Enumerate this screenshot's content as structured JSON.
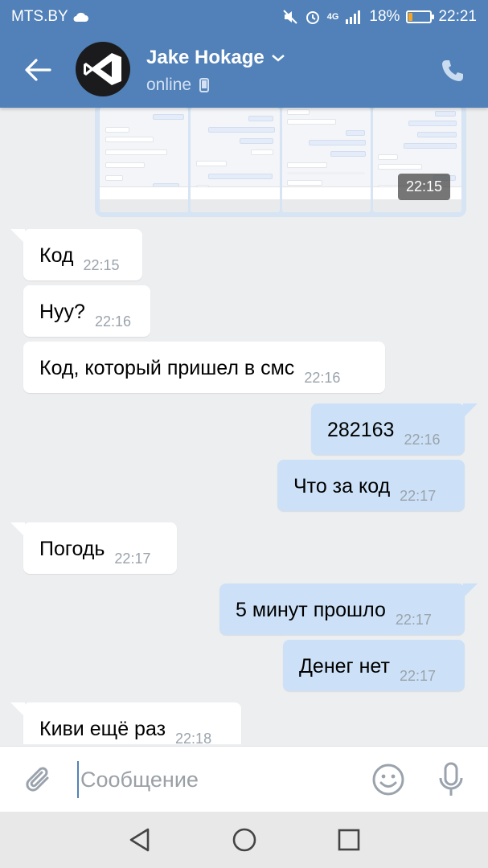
{
  "status_bar": {
    "carrier": "MTS.BY",
    "network": "4G",
    "battery": "18%",
    "battery_level": 0.18,
    "time": "22:21"
  },
  "header": {
    "name": "Jake Hokage",
    "status": "online",
    "back_icon": "arrow-left-icon",
    "call_icon": "phone-icon",
    "accent": "#5181b8"
  },
  "screenshot_attachment": {
    "time": "22:15"
  },
  "messages": [
    {
      "dir": "in",
      "text": "Код",
      "time": "22:15"
    },
    {
      "dir": "in",
      "text": "Нуу?",
      "time": "22:16"
    },
    {
      "dir": "in",
      "text": "Код, который пришел в смс",
      "time": "22:16"
    },
    {
      "dir": "out",
      "text": "282163",
      "time": "22:16"
    },
    {
      "dir": "out",
      "text": "Что за код",
      "time": "22:17"
    },
    {
      "dir": "in",
      "text": "Погодь",
      "time": "22:17"
    },
    {
      "dir": "out",
      "text": "5 минут прошло",
      "time": "22:17"
    },
    {
      "dir": "out",
      "text": "Денег нет",
      "time": "22:17"
    },
    {
      "dir": "in",
      "text": "Киви ещё раз",
      "time": "22:18"
    }
  ],
  "composer": {
    "placeholder": "Сообщение",
    "value": ""
  },
  "colors": {
    "outgoing_bubble": "#cce1f7",
    "incoming_bubble": "#ffffff",
    "chat_background": "#edeef0"
  }
}
